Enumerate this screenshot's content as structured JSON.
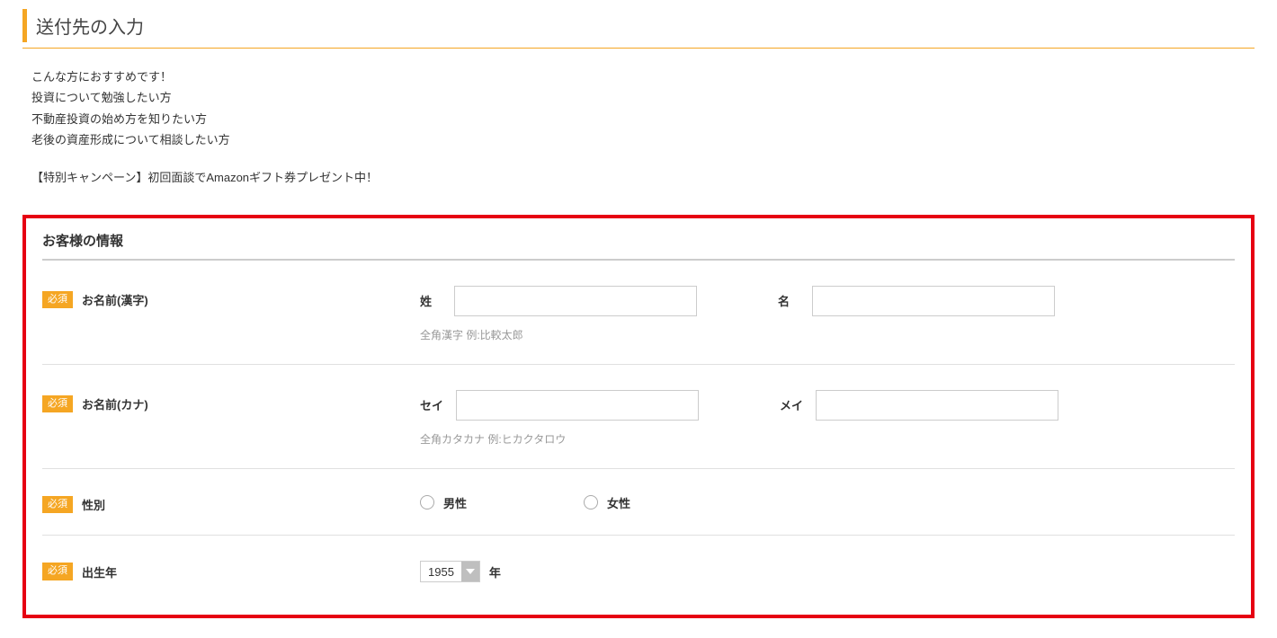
{
  "page": {
    "title": "送付先の入力"
  },
  "intro": {
    "line1": "こんな方におすすめです！",
    "line2": "投資について勉強したい方",
    "line3": "不動産投資の始め方を知りたい方",
    "line4": "老後の資産形成について相談したい方",
    "campaign": "【特別キャンペーン】初回面談でAmazonギフト券プレゼント中！"
  },
  "form": {
    "section_title": "お客様の情報",
    "required_label": "必須",
    "fields": {
      "name_kanji": {
        "label": "お名前(漢字)",
        "sei_label": "姓",
        "mei_label": "名",
        "sei_value": "",
        "mei_value": "",
        "hint": "全角漢字 例:比較太郎"
      },
      "name_kana": {
        "label": "お名前(カナ)",
        "sei_label": "セイ",
        "mei_label": "メイ",
        "sei_value": "",
        "mei_value": "",
        "hint": "全角カタカナ 例:ヒカクタロウ"
      },
      "gender": {
        "label": "性別",
        "male": "男性",
        "female": "女性"
      },
      "birth_year": {
        "label": "出生年",
        "value": "1955",
        "suffix": "年"
      }
    }
  }
}
